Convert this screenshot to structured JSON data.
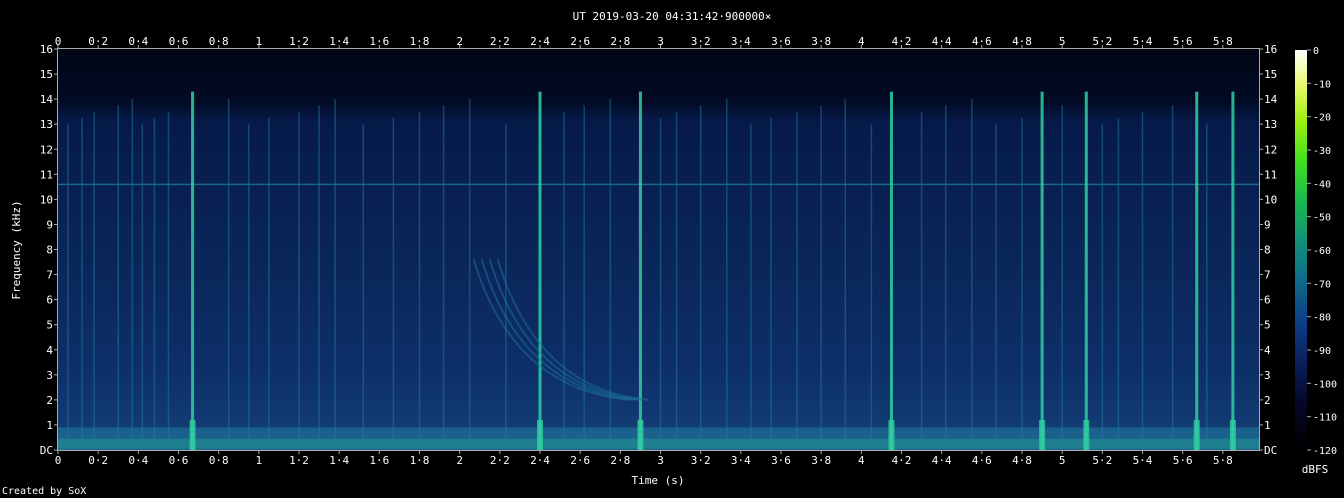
{
  "chart_data": {
    "type": "heatmap",
    "title": "UT 2019-03-20 04:31:42·900000×",
    "xlabel": "Time (s)",
    "ylabel": "Frequency (kHz)",
    "xlim": [
      0,
      5.98
    ],
    "ylim": [
      0,
      16
    ],
    "x_ticks": [
      "0",
      "0·2",
      "0·4",
      "0·6",
      "0·8",
      "1",
      "1·2",
      "1·4",
      "1·6",
      "1·8",
      "2",
      "2·2",
      "2·4",
      "2·6",
      "2·8",
      "3",
      "3·2",
      "3·4",
      "3·6",
      "3·8",
      "4",
      "4·2",
      "4·4",
      "4·6",
      "4·8",
      "5",
      "5·2",
      "5·4",
      "5·6",
      "5·8"
    ],
    "y_ticks": [
      "DC",
      "1",
      "2",
      "3",
      "4",
      "5",
      "6",
      "7",
      "8",
      "9",
      "10",
      "11",
      "12",
      "13",
      "14",
      "15",
      "16"
    ],
    "colorbar": {
      "label": "dBFS",
      "ticks": [
        "0",
        "-10",
        "-20",
        "-30",
        "-40",
        "-50",
        "-60",
        "-70",
        "-80",
        "-90",
        "-100",
        "-110",
        "-120"
      ],
      "range": [
        -120,
        0
      ]
    },
    "grid": false,
    "colors": {
      "background": "#000000",
      "plot_floor": "#030a20",
      "noise": "#0d2a66",
      "stripe": "#1f7a9e",
      "bright": "#2fd0a0"
    },
    "features": {
      "vertical_transients_s": [
        0.05,
        0.12,
        0.18,
        0.3,
        0.37,
        0.42,
        0.48,
        0.55,
        0.67,
        0.85,
        0.95,
        1.05,
        1.2,
        1.3,
        1.38,
        1.52,
        1.67,
        1.8,
        1.92,
        2.05,
        2.23,
        2.4,
        2.52,
        2.62,
        2.75,
        2.9,
        3.0,
        3.08,
        3.2,
        3.33,
        3.45,
        3.55,
        3.68,
        3.8,
        3.92,
        4.05,
        4.15,
        4.3,
        4.42,
        4.55,
        4.67,
        4.8,
        4.9,
        5.0,
        5.12,
        5.2,
        5.28,
        5.4,
        5.55,
        5.67,
        5.72,
        5.85
      ],
      "bright_transients_s": [
        0.67,
        2.4,
        2.9,
        4.15,
        4.9,
        5.12,
        5.67,
        5.85
      ],
      "dispersed_whistler": {
        "t_start_s": 2.07,
        "f_start_khz": 7.6,
        "t_end_s": 2.85,
        "f_end_khz": 2.0
      },
      "tone_khz": 10.6,
      "low_freq_band_khz": [
        0,
        0.9
      ]
    }
  },
  "footer": {
    "credit": "Created by SoX"
  }
}
